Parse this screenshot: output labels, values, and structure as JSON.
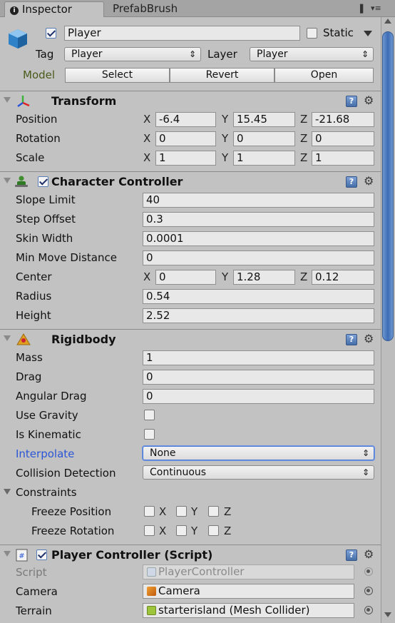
{
  "tabs": [
    {
      "label": "Inspector"
    },
    {
      "label": "PrefabBrush"
    }
  ],
  "header": {
    "name_value": "Player",
    "static_label": "Static",
    "tag_label": "Tag",
    "tag_value": "Player",
    "layer_label": "Layer",
    "layer_value": "Player",
    "model_label": "Model",
    "select_label": "Select",
    "revert_label": "Revert",
    "open_label": "Open"
  },
  "transform": {
    "title": "Transform",
    "position_label": "Position",
    "rotation_label": "Rotation",
    "scale_label": "Scale",
    "position": {
      "x": "-6.4",
      "y": "15.45",
      "z": "-21.68"
    },
    "rotation": {
      "x": "0",
      "y": "0",
      "z": "0"
    },
    "scale": {
      "x": "1",
      "y": "1",
      "z": "1"
    }
  },
  "axes": {
    "x": "X",
    "y": "Y",
    "z": "Z"
  },
  "character_controller": {
    "title": "Character Controller",
    "slope_limit_label": "Slope Limit",
    "slope_limit": "40",
    "step_offset_label": "Step Offset",
    "step_offset": "0.3",
    "skin_width_label": "Skin Width",
    "skin_width": "0.0001",
    "min_move_label": "Min Move Distance",
    "min_move": "0",
    "center_label": "Center",
    "center": {
      "x": "0",
      "y": "1.28",
      "z": "0.12"
    },
    "radius_label": "Radius",
    "radius": "0.54",
    "height_label": "Height",
    "height": "2.52"
  },
  "rigidbody": {
    "title": "Rigidbody",
    "mass_label": "Mass",
    "mass": "1",
    "drag_label": "Drag",
    "drag": "0",
    "angular_drag_label": "Angular Drag",
    "angular_drag": "0",
    "use_gravity_label": "Use Gravity",
    "use_gravity": false,
    "is_kinematic_label": "Is Kinematic",
    "is_kinematic": false,
    "interpolate_label": "Interpolate",
    "interpolate_value": "None",
    "collision_label": "Collision Detection",
    "collision_value": "Continuous",
    "constraints_label": "Constraints",
    "freeze_position_label": "Freeze Position",
    "freeze_rotation_label": "Freeze Rotation"
  },
  "player_controller": {
    "title": "Player Controller (Script)",
    "script_label": "Script",
    "script_value": "PlayerController",
    "camera_label": "Camera",
    "camera_value": "Camera",
    "terrain_label": "Terrain",
    "terrain_value": "starterisland (Mesh Collider)"
  },
  "icons": {
    "help": "?",
    "gear": "⚙",
    "dropdown_arrow": "⬍",
    "lock": "🔒",
    "menu": "▾≡"
  },
  "colors": {
    "panel_bg": "#c2c2c2",
    "field_bg": "#e8e8e8",
    "accent_blue": "#2a55d6",
    "scroll_thumb": "#4a78bd"
  }
}
